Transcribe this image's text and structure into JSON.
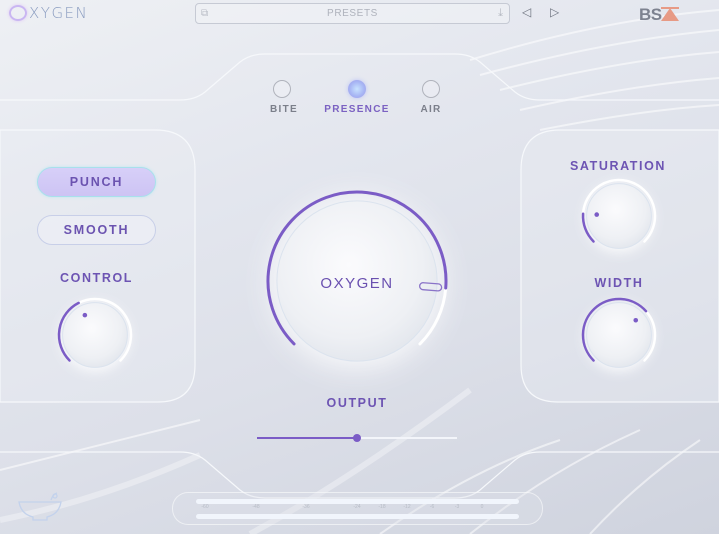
{
  "app": {
    "title": "OXYGEN",
    "brand": "BS"
  },
  "topbar": {
    "presets_label": "PRESETS",
    "prev_label": "◁",
    "next_label": "▷"
  },
  "modes": [
    {
      "label": "BITE",
      "selected": false
    },
    {
      "label": "PRESENCE",
      "selected": true
    },
    {
      "label": "AIR",
      "selected": false
    }
  ],
  "left_panel": {
    "punch_label": "PUNCH",
    "punch_active": true,
    "smooth_label": "SMOOTH",
    "smooth_active": false,
    "control_label": "CONTROL",
    "control_value": 0.4
  },
  "center": {
    "main_knob_label": "OXYGEN",
    "main_knob_value": 0.85,
    "output_label": "OUTPUT",
    "output_value": 0.5
  },
  "right_panel": {
    "saturation_label": "SATURATION",
    "saturation_value": 0.18,
    "width_label": "WIDTH",
    "width_value": 0.68
  },
  "meter": {
    "scale": [
      "-60",
      "-48",
      "-36",
      "-24",
      "-18",
      "-12",
      "-6",
      "-3",
      "0"
    ]
  },
  "colors": {
    "accent": "#7b5cc6",
    "track": "#ffffff",
    "brand_triangle": "#e79a85"
  }
}
